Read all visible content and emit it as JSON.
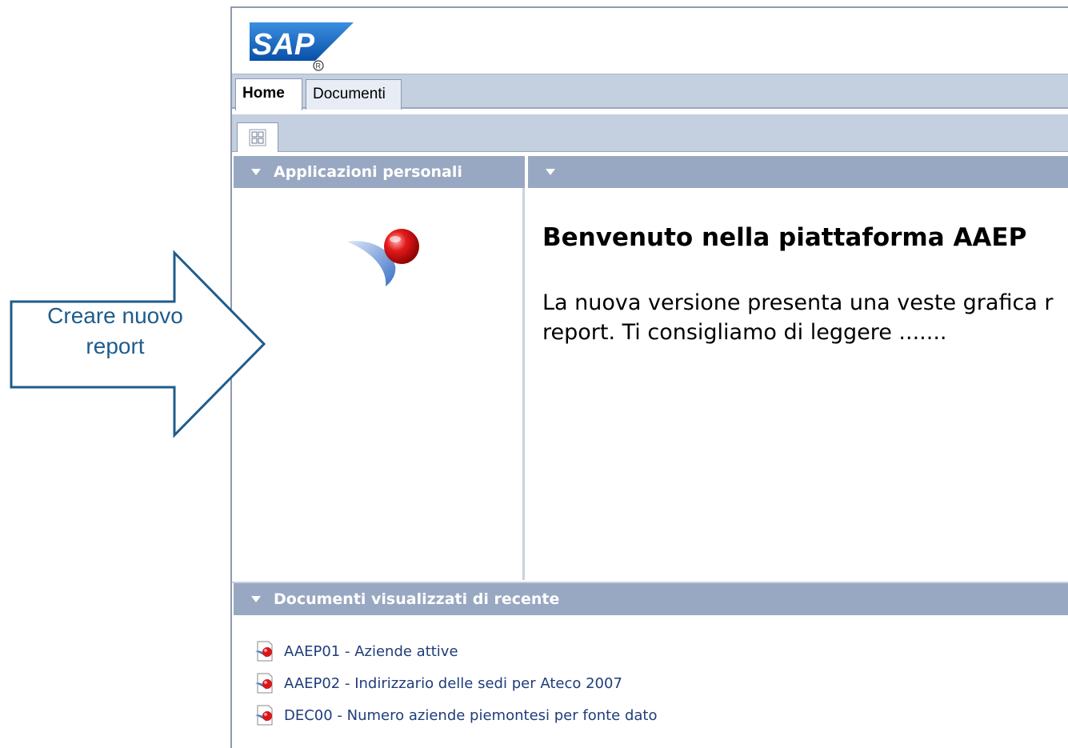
{
  "tabs": [
    {
      "label": "Home",
      "active": true
    },
    {
      "label": "Documenti",
      "active": false
    }
  ],
  "toolbar": {
    "grid_icon": "grid-view-icon"
  },
  "panels": {
    "left_title": "Applicazioni personali",
    "right_title": "",
    "bottom_title": "Documenti visualizzati di recente"
  },
  "welcome": {
    "title": "Benvenuto nella piattaforma AAEP",
    "line1": "La nuova versione presenta una veste grafica r",
    "line2": "report. Ti consigliamo di leggere ......."
  },
  "recent_documents": [
    {
      "label": "AAEP01 - Aziende attive"
    },
    {
      "label": "AAEP02 - Indirizzario delle sedi per Ateco 2007"
    },
    {
      "label": "DEC00 - Numero aziende piemontesi per fonte dato"
    }
  ],
  "callout": {
    "line1": "Creare nuovo",
    "line2": "report"
  },
  "colors": {
    "panel_header": "#98a8c2",
    "tab_bar": "#c4cfe0",
    "link": "#1f3d7a",
    "callout": "#1f5c8b"
  }
}
